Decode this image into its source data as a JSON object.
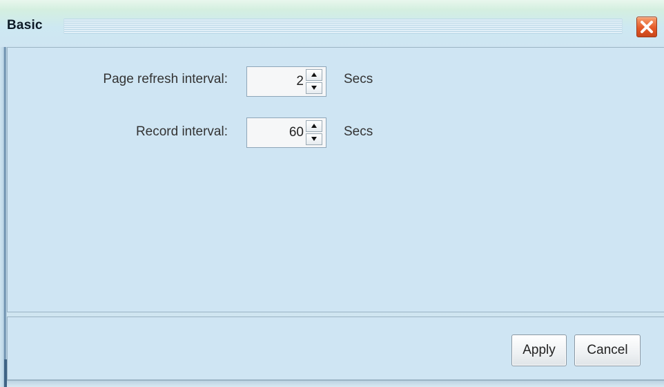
{
  "window": {
    "title": "Basic",
    "close_icon": "close-icon"
  },
  "form": {
    "fields": [
      {
        "label": "Page refresh interval:",
        "value": "2",
        "unit": "Secs"
      },
      {
        "label": "Record interval:",
        "value": "60",
        "unit": "Secs"
      }
    ]
  },
  "footer": {
    "apply_label": "Apply",
    "cancel_label": "Cancel"
  },
  "colors": {
    "panel_background": "#cfe5f3",
    "close_button": "#e45a28"
  }
}
